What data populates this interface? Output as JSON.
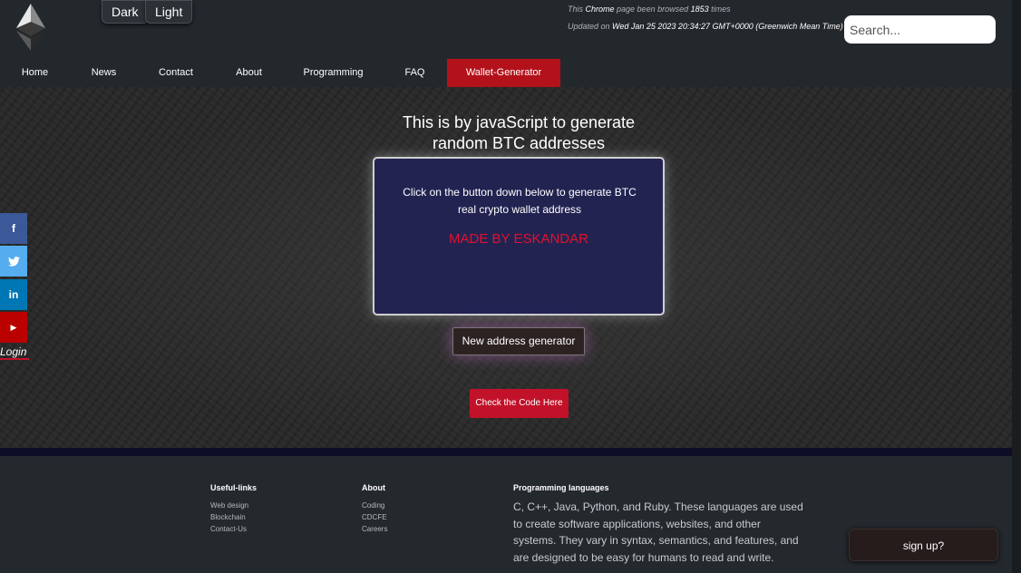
{
  "header": {
    "theme": {
      "dark_label": "Dark",
      "light_label": "Light"
    },
    "browse_info": {
      "prefix": "This ",
      "browser": "Chrome",
      "middle": " page been browsed ",
      "count": "1853",
      "suffix": " times"
    },
    "update_info": {
      "prefix": "Updated on ",
      "date": "Wed Jan 25 2023 20:34:27 GMT+0000 (Greenwich Mean Time)"
    },
    "search": {
      "placeholder": "Search..."
    },
    "nav": [
      "Home",
      "News",
      "Contact",
      "About",
      "Programming",
      "FAQ",
      "Wallet-Generator"
    ],
    "active_nav": "Wallet-Generator",
    "logo_icon": "ethereum-diamond-icon"
  },
  "main": {
    "title_line1": "This is by javaScript to generate",
    "title_line2": "random BTC addresses",
    "card_line1": "Click on the button down below to generate BTC",
    "card_line2": "real crypto wallet address",
    "credit": "MADE BY ESKANDAR",
    "generate_button": "New address generator",
    "code_button": "Check the Code Here"
  },
  "social": {
    "icons": [
      "facebook-icon",
      "twitter-icon",
      "linkedin-icon",
      "youtube-icon"
    ],
    "facebook_glyph": "f",
    "twitter_glyph": "🐦",
    "linkedin_glyph": "in",
    "youtube_glyph": "▶",
    "login": "Login"
  },
  "footer": {
    "useful": {
      "title": "Useful-links",
      "links": [
        "Web design",
        "Blockchain",
        "Contact-Us"
      ]
    },
    "about": {
      "title": "About",
      "links": [
        "Coding",
        "CDCFE",
        "Careers"
      ]
    },
    "programming": {
      "title": "Programming languages",
      "text": "C, C++, Java, Python, and Ruby. These languages are used to create software applications, websites, and other systems. They vary in syntax, semantics, and features, and are designed to be easy for humans to read and write."
    }
  },
  "signup": "sign up?",
  "colors": {
    "accent_red": "#b3121b",
    "card_bg": "#232352",
    "credit_red": "#e3102c"
  }
}
